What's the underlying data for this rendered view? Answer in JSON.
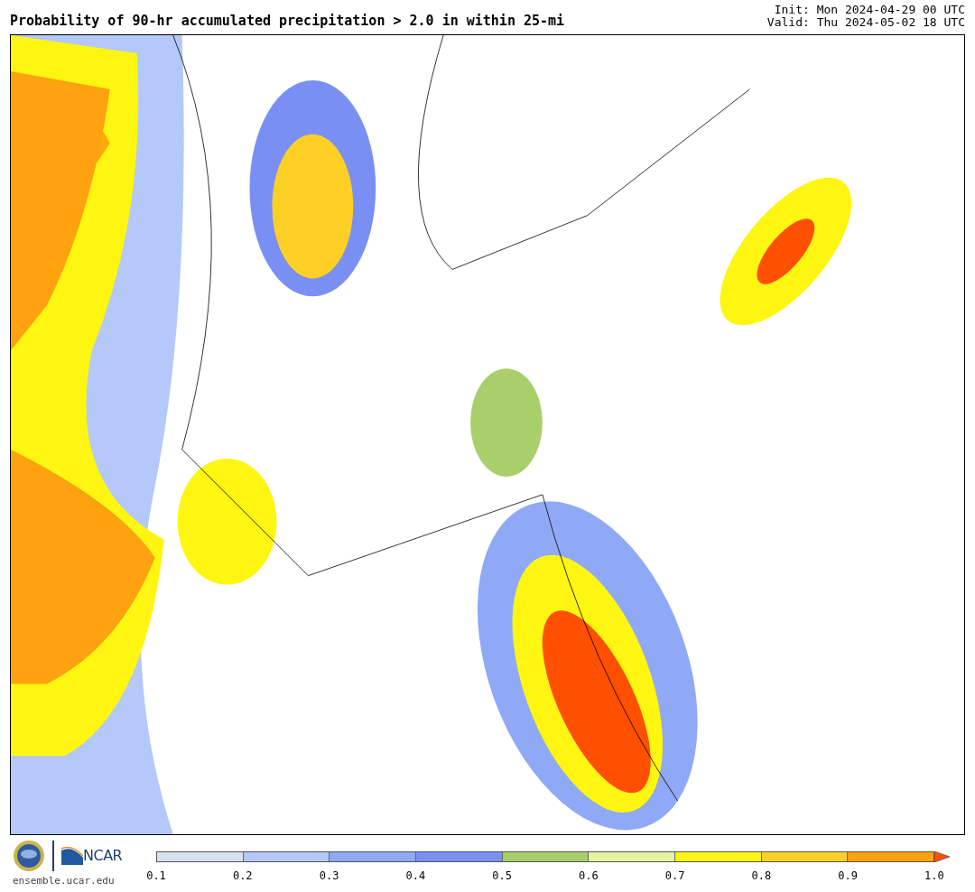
{
  "title": "Probability of 90-hr accumulated precipitation > 2.0 in within 25-mi",
  "init": "Init: Mon 2024-04-29 00 UTC",
  "valid": "Valid: Thu 2024-05-02 18 UTC",
  "footer": {
    "logo_text": "NCAR",
    "website": "ensemble.ucar.edu"
  },
  "colorbar": {
    "bins": [
      {
        "kind": "band",
        "color": "#d6e2ed"
      },
      {
        "kind": "band",
        "color": "#b4c8fa"
      },
      {
        "kind": "band",
        "color": "#8fa9f7"
      },
      {
        "kind": "band",
        "color": "#7a8ff3"
      },
      {
        "kind": "band",
        "color": "#a8cf6a"
      },
      {
        "kind": "band",
        "color": "#e6f5a2"
      },
      {
        "kind": "band",
        "color": "#fef611"
      },
      {
        "kind": "band",
        "color": "#fed025"
      },
      {
        "kind": "band",
        "color": "#fea20f"
      },
      {
        "kind": "arrow",
        "color": "#ff4f00"
      }
    ],
    "ticks": [
      "0.1",
      "0.2",
      "0.3",
      "0.4",
      "0.5",
      "0.6",
      "0.7",
      "0.8",
      "0.9",
      "1.0"
    ]
  }
}
